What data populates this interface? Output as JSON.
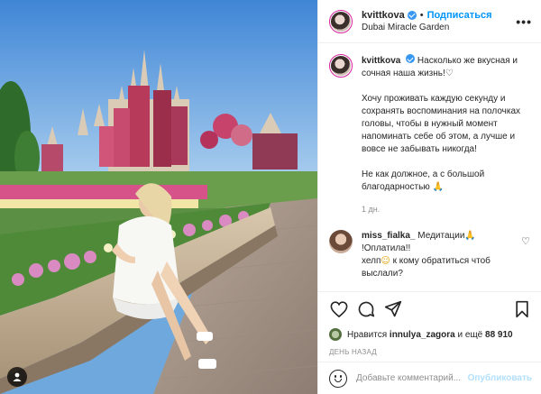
{
  "header": {
    "username": "kvittkova",
    "follow_label": "Подписаться",
    "location": "Dubai Miracle Garden",
    "separator": "•",
    "more_glyph": "•••"
  },
  "caption": {
    "username": "kvittkova",
    "line1": "Насколько же вкусная и сочная наша жизнь!",
    "line1_emoji": "♡",
    "paragraph2": "Хочу проживать каждую секунду и сохранять воспоминания на полочках головы, чтобы в нужный момент напоминать себе об этом, а лучше и вовсе не забывать никогда!",
    "paragraph3": "Не как должное, а с большой благодарностью",
    "paragraph3_emoji": "🙏",
    "timestamp": "1 дн."
  },
  "comments": [
    {
      "username": "miss_fialka_",
      "text1": "Медитации",
      "emoji1": "🙏",
      "text2": "!Оплатила!!",
      "text3_pre": "хелп",
      "emoji2": "☺",
      "text3_post": " к кому обратиться чтоб выслали?"
    }
  ],
  "likes": {
    "prefix": "Нравится ",
    "user": "innulya_zagora",
    "middle": " и ещё ",
    "count": "88 910"
  },
  "post_date": "ДЕНЬ НАЗАД",
  "add_comment": {
    "placeholder": "Добавьте комментарий...",
    "publish_label": "Опубликовать"
  },
  "colors": {
    "accent": "#0095f6",
    "verified": "#3897f0",
    "publish_disabled": "#b2dffc",
    "muted": "#8e8e8e"
  }
}
